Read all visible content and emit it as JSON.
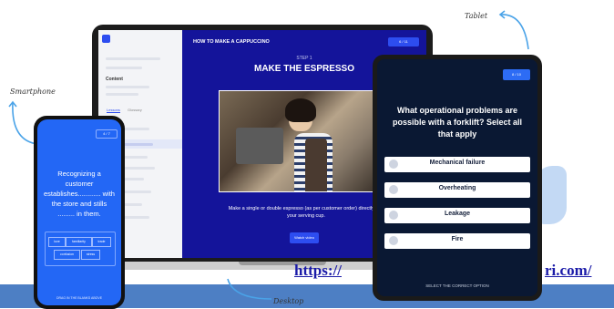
{
  "captions": {
    "tablet": "Tablet",
    "smartphone": "Smartphone",
    "desktop": "Desktop"
  },
  "desktop": {
    "title": "HOW TO MAKE A CAPPUCCINO",
    "counter": "6 / 11",
    "sidebar_heading": "Content",
    "tab_lessons": "Lessons",
    "tab_glossary": "Glossary",
    "step": "STEP 1",
    "heading": "MAKE THE ESPRESSO",
    "body": "Make a single or double espresso (as per customer order) directly into your serving cup.",
    "button": "Watch video"
  },
  "phone": {
    "counter": "4 / 7",
    "question": "Recognizing a customer establishes............ with the store and stills ......... in them.",
    "chips": [
      "love",
      "familiarity",
      "trade",
      "confusion",
      "stress"
    ],
    "footer": "DRAG IN THE BLANKS ABOVE"
  },
  "tablet": {
    "counter": "8 / 10",
    "question": "What operational problems are possible with a forklift? Select all that apply",
    "options": [
      "Mechanical failure",
      "Overheating",
      "Leakage",
      "Fire"
    ],
    "footer": "SELECT THE CORRECT OPTION"
  },
  "watermark": {
    "left": "https://",
    "right": "ri.com/"
  },
  "colors": {
    "brand_blue": "#2367f5",
    "desktop_bg": "#14149a",
    "tablet_bg": "#0a1833",
    "link": "#1a1aa8",
    "stripe": "#4d7fc4"
  }
}
